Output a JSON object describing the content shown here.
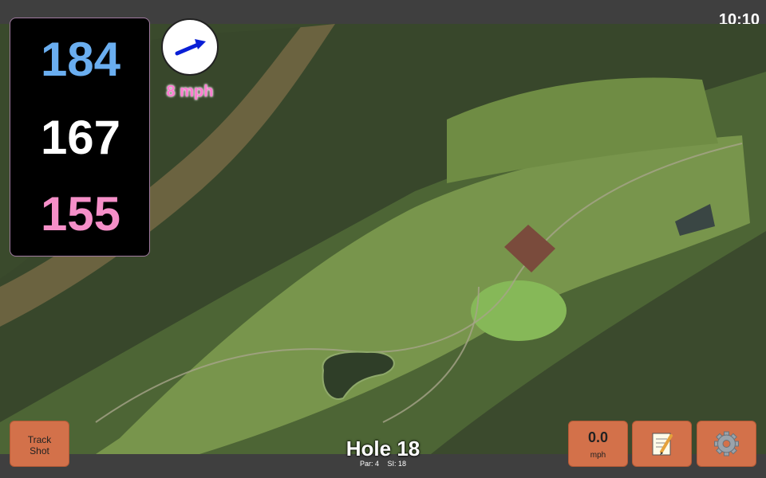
{
  "status_bar": {
    "time": "10:10"
  },
  "distances": {
    "back": "184",
    "middle": "167",
    "front": "155",
    "colors": {
      "back": "#6aaef0",
      "middle": "#ffffff",
      "front": "#f58fc8"
    }
  },
  "wind": {
    "speed_label": "8 mph",
    "direction_icon": "wind-direction-arrow-icon"
  },
  "buttons": {
    "track_shot_line1": "Track",
    "track_shot_line2": "Shot",
    "speed_value": "0.0",
    "speed_unit": "mph",
    "notes_icon": "notepad-icon",
    "settings_icon": "gear-icon"
  },
  "hole": {
    "title": "Hole 18",
    "par_label": "Par: 4",
    "si_label": "SI: 18"
  },
  "colors": {
    "button_bg": "#d3714a",
    "bar_bg": "#3f3f3f"
  }
}
